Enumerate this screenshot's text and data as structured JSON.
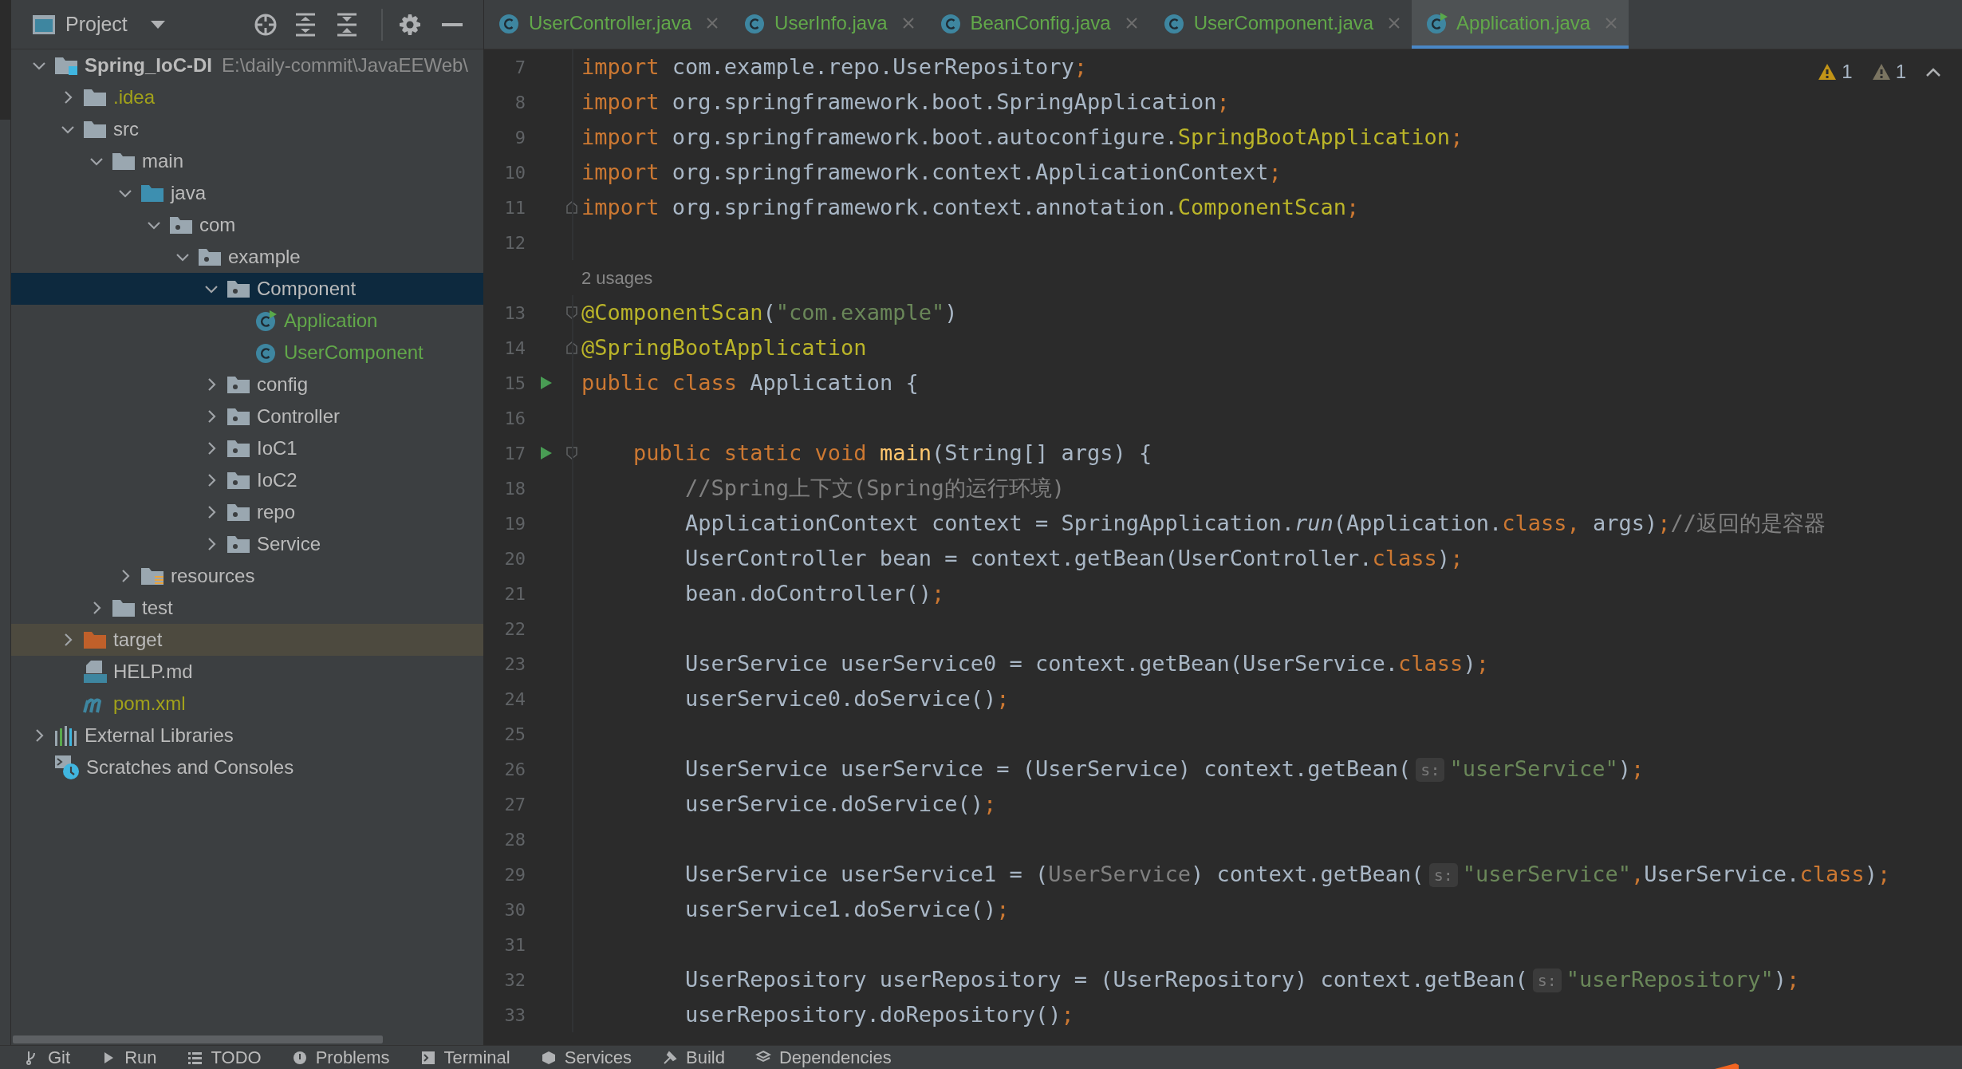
{
  "project_panel": {
    "title": "Project",
    "tree": [
      {
        "label": "Spring_IoC-DI",
        "path": "E:\\daily-commit\\JavaEEWeb\\",
        "kind": "module",
        "expanded": true,
        "selected": false,
        "children": [
          {
            "label": ".idea",
            "kind": "folder",
            "expanded": false,
            "selected": false,
            "color": "#a2a21a"
          },
          {
            "label": "src",
            "kind": "folder",
            "expanded": true,
            "selected": false,
            "children": [
              {
                "label": "main",
                "kind": "folder",
                "expanded": true,
                "selected": false,
                "children": [
                  {
                    "label": "java",
                    "kind": "source",
                    "expanded": true,
                    "selected": false,
                    "children": [
                      {
                        "label": "com",
                        "kind": "package",
                        "expanded": true,
                        "selected": false,
                        "children": [
                          {
                            "label": "example",
                            "kind": "package",
                            "expanded": true,
                            "selected": false,
                            "children": [
                              {
                                "label": "Component",
                                "kind": "package",
                                "expanded": true,
                                "selected": true,
                                "children": [
                                  {
                                    "label": "Application",
                                    "kind": "runnable-class",
                                    "selected": false,
                                    "color": "#62a84a"
                                  },
                                  {
                                    "label": "UserComponent",
                                    "kind": "class",
                                    "selected": false,
                                    "color": "#62a84a"
                                  }
                                ]
                              },
                              {
                                "label": "config",
                                "kind": "package",
                                "expanded": false,
                                "selected": false
                              },
                              {
                                "label": "Controller",
                                "kind": "package",
                                "expanded": false,
                                "selected": false
                              },
                              {
                                "label": "IoC1",
                                "kind": "package",
                                "expanded": false,
                                "selected": false
                              },
                              {
                                "label": "IoC2",
                                "kind": "package",
                                "expanded": false,
                                "selected": false
                              },
                              {
                                "label": "repo",
                                "kind": "package",
                                "expanded": false,
                                "selected": false
                              },
                              {
                                "label": "Service",
                                "kind": "package",
                                "expanded": false,
                                "selected": false
                              }
                            ]
                          }
                        ]
                      }
                    ]
                  },
                  {
                    "label": "resources",
                    "kind": "resources",
                    "expanded": false,
                    "selected": false
                  }
                ]
              },
              {
                "label": "test",
                "kind": "folder",
                "expanded": false,
                "selected": false
              }
            ]
          },
          {
            "label": "target",
            "kind": "excluded",
            "expanded": false,
            "selected": false,
            "highlighted": true
          },
          {
            "label": "HELP.md",
            "kind": "markdown",
            "selected": false
          },
          {
            "label": "pom.xml",
            "kind": "maven",
            "selected": false,
            "color": "#a2a21a"
          }
        ]
      },
      {
        "label": "External Libraries",
        "kind": "libraries",
        "expanded": false,
        "selected": false
      },
      {
        "label": "Scratches and Consoles",
        "kind": "scratches",
        "selected": false
      }
    ]
  },
  "tabs": [
    {
      "label": "UserController.java",
      "kind": "class",
      "selected": false
    },
    {
      "label": "UserInfo.java",
      "kind": "class",
      "selected": false
    },
    {
      "label": "BeanConfig.java",
      "kind": "class",
      "selected": false
    },
    {
      "label": "UserComponent.java",
      "kind": "class",
      "selected": false
    },
    {
      "label": "Application.java",
      "kind": "runnable-class",
      "selected": true
    }
  ],
  "inspections": [
    {
      "kind": "warning",
      "count": "1"
    },
    {
      "kind": "weak-warning",
      "count": "1"
    }
  ],
  "editor": {
    "lines": [
      {
        "kind": "code",
        "number": "7",
        "tokens": [
          {
            "kind": "kw",
            "text": "import "
          },
          {
            "kind": "plain",
            "text": "com.example.repo.UserRepository"
          },
          {
            "kind": "kw",
            "text": ";"
          }
        ]
      },
      {
        "kind": "code",
        "number": "8",
        "tokens": [
          {
            "kind": "kw",
            "text": "import "
          },
          {
            "kind": "plain",
            "text": "org.springframework.boot.SpringApplication"
          },
          {
            "kind": "kw",
            "text": ";"
          }
        ]
      },
      {
        "kind": "code",
        "number": "9",
        "tokens": [
          {
            "kind": "kw",
            "text": "import "
          },
          {
            "kind": "plain",
            "text": "org.springframework.boot.autoconfigure."
          },
          {
            "kind": "ann",
            "text": "SpringBootApplication"
          },
          {
            "kind": "kw",
            "text": ";"
          }
        ]
      },
      {
        "kind": "code",
        "number": "10",
        "tokens": [
          {
            "kind": "kw",
            "text": "import "
          },
          {
            "kind": "plain",
            "text": "org.springframework.context.ApplicationContext"
          },
          {
            "kind": "kw",
            "text": ";"
          }
        ]
      },
      {
        "kind": "code",
        "number": "11",
        "fold_end": true,
        "tokens": [
          {
            "kind": "kw",
            "text": "import "
          },
          {
            "kind": "plain",
            "text": "org.springframework.context.annotation."
          },
          {
            "kind": "ann",
            "text": "ComponentScan"
          },
          {
            "kind": "kw",
            "text": ";"
          }
        ]
      },
      {
        "kind": "code",
        "number": "12"
      },
      {
        "kind": "usages",
        "text": "2 usages"
      },
      {
        "kind": "code",
        "number": "13",
        "fold_start": true,
        "tokens": [
          {
            "kind": "ann",
            "text": "@ComponentScan"
          },
          {
            "kind": "plain",
            "text": "("
          },
          {
            "kind": "str",
            "text": "\"com.example\""
          },
          {
            "kind": "plain",
            "text": ")"
          }
        ]
      },
      {
        "kind": "code",
        "number": "14",
        "fold_end": true,
        "tokens": [
          {
            "kind": "ann",
            "text": "@SpringBootApplication"
          }
        ]
      },
      {
        "kind": "code",
        "number": "15",
        "run": true,
        "tokens": [
          {
            "kind": "kw",
            "text": "public class "
          },
          {
            "kind": "plain",
            "text": "Application {"
          }
        ]
      },
      {
        "kind": "code",
        "number": "16"
      },
      {
        "kind": "code",
        "number": "17",
        "run": true,
        "fold_start": true,
        "tokens": [
          {
            "kind": "kw",
            "text": "    public static void "
          },
          {
            "kind": "fn",
            "text": "main"
          },
          {
            "kind": "plain",
            "text": "(String[] args) {"
          }
        ]
      },
      {
        "kind": "code",
        "number": "18",
        "tokens": [
          {
            "kind": "cmt",
            "text": "        //Spring上下文(Spring的运行环境)"
          }
        ]
      },
      {
        "kind": "code",
        "number": "19",
        "tokens": [
          {
            "kind": "plain",
            "text": "        ApplicationContext context = SpringApplication."
          },
          {
            "kind": "static",
            "text": "run"
          },
          {
            "kind": "plain",
            "text": "(Application."
          },
          {
            "kind": "kw",
            "text": "class, "
          },
          {
            "kind": "plain",
            "text": "args)"
          },
          {
            "kind": "kw",
            "text": ";"
          },
          {
            "kind": "cmt",
            "text": "//返回的是容器"
          }
        ]
      },
      {
        "kind": "code",
        "number": "20",
        "tokens": [
          {
            "kind": "plain",
            "text": "        UserController bean = context.getBean(UserController."
          },
          {
            "kind": "kw",
            "text": "class"
          },
          {
            "kind": "plain",
            "text": ")"
          },
          {
            "kind": "kw",
            "text": ";"
          }
        ]
      },
      {
        "kind": "code",
        "number": "21",
        "tokens": [
          {
            "kind": "plain",
            "text": "        bean.doController()"
          },
          {
            "kind": "kw",
            "text": ";"
          }
        ]
      },
      {
        "kind": "code",
        "number": "22"
      },
      {
        "kind": "code",
        "number": "23",
        "tokens": [
          {
            "kind": "plain",
            "text": "        UserService userService0 = context.getBean(UserService."
          },
          {
            "kind": "kw",
            "text": "class"
          },
          {
            "kind": "plain",
            "text": ")"
          },
          {
            "kind": "kw",
            "text": ";"
          }
        ]
      },
      {
        "kind": "code",
        "number": "24",
        "tokens": [
          {
            "kind": "plain",
            "text": "        userService0.doService()"
          },
          {
            "kind": "kw",
            "text": ";"
          }
        ]
      },
      {
        "kind": "code",
        "number": "25"
      },
      {
        "kind": "code",
        "number": "26",
        "tokens": [
          {
            "kind": "plain",
            "text": "        UserService userService = (UserService) context.getBean("
          },
          {
            "kind": "hint",
            "text": "s:"
          },
          {
            "kind": "str",
            "text": "\"userService\""
          },
          {
            "kind": "plain",
            "text": ")"
          },
          {
            "kind": "kw",
            "text": ";"
          }
        ]
      },
      {
        "kind": "code",
        "number": "27",
        "tokens": [
          {
            "kind": "plain",
            "text": "        userService.doService()"
          },
          {
            "kind": "kw",
            "text": ";"
          }
        ]
      },
      {
        "kind": "code",
        "number": "28"
      },
      {
        "kind": "code",
        "number": "29",
        "tokens": [
          {
            "kind": "plain",
            "text": "        UserService userService1 = ("
          },
          {
            "kind": "dim",
            "text": "UserService"
          },
          {
            "kind": "plain",
            "text": ") context.getBean("
          },
          {
            "kind": "hint",
            "text": "s:"
          },
          {
            "kind": "str",
            "text": "\"userService\""
          },
          {
            "kind": "kw",
            "text": ","
          },
          {
            "kind": "plain",
            "text": "UserService."
          },
          {
            "kind": "kw",
            "text": "class"
          },
          {
            "kind": "plain",
            "text": ")"
          },
          {
            "kind": "kw",
            "text": ";"
          }
        ]
      },
      {
        "kind": "code",
        "number": "30",
        "tokens": [
          {
            "kind": "plain",
            "text": "        userService1.doService()"
          },
          {
            "kind": "kw",
            "text": ";"
          }
        ]
      },
      {
        "kind": "code",
        "number": "31"
      },
      {
        "kind": "code",
        "number": "32",
        "tokens": [
          {
            "kind": "plain",
            "text": "        UserRepository userRepository = (UserRepository) context.getBean("
          },
          {
            "kind": "hint",
            "text": "s:"
          },
          {
            "kind": "str",
            "text": "\"userRepository\""
          },
          {
            "kind": "plain",
            "text": ")"
          },
          {
            "kind": "kw",
            "text": ";"
          }
        ]
      },
      {
        "kind": "code",
        "number": "33",
        "tokens": [
          {
            "kind": "plain",
            "text": "        userRepository.doRepository()"
          },
          {
            "kind": "kw",
            "text": ";"
          }
        ]
      }
    ]
  },
  "tool_windows": [
    {
      "kind": "git",
      "label": "Git"
    },
    {
      "kind": "run",
      "label": "Run"
    },
    {
      "kind": "todo",
      "label": "TODO"
    },
    {
      "kind": "problems",
      "label": "Problems"
    },
    {
      "kind": "terminal",
      "label": "Terminal"
    },
    {
      "kind": "services",
      "label": "Services"
    },
    {
      "kind": "build",
      "label": "Build"
    },
    {
      "kind": "dependencies",
      "label": "Dependencies"
    }
  ]
}
